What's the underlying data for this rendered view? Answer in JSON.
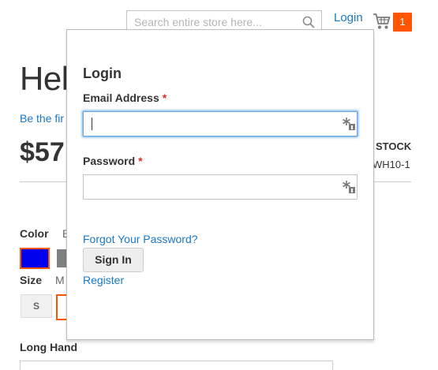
{
  "header": {
    "search_placeholder": "Search entire store here...",
    "login_label": "Login",
    "cart_count": "1"
  },
  "product": {
    "title_fragment": "Hel",
    "review_fragment": "Be the fir",
    "price_fragment": "$57",
    "stock_fragment": "STOCK",
    "sku_fragment": "WH10-1",
    "color_label": "Color",
    "color_value_fragment": "B",
    "size_label": "Size",
    "size_value_fragment": "M",
    "size_option_s": "S",
    "long_hand_label": "Long Hand"
  },
  "login_panel": {
    "title": "Login",
    "email_label": "Email Address",
    "email_value": "",
    "password_label": "Password",
    "password_value": "",
    "required_mark": "*",
    "forgot_link": "Forgot Your Password?",
    "signin_label": "Sign In",
    "register_link": "Register"
  },
  "colors": {
    "accent": "#ff5501",
    "link": "#1979c3",
    "required": "#e02b27",
    "swatch_selected": "#0000ee",
    "swatch_gray": "#808080"
  },
  "icons": [
    "search-icon",
    "cart-icon",
    "password-manager-icon"
  ]
}
